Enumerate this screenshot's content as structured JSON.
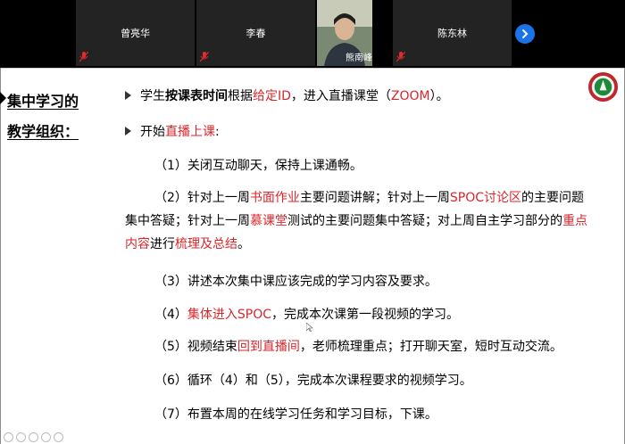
{
  "participants": [
    {
      "name": "曾亮华",
      "muted": true
    },
    {
      "name": "李春",
      "muted": true
    },
    {
      "name": "熊南峰",
      "video": true
    },
    {
      "name": "陈东林",
      "muted": true
    }
  ],
  "nav": {
    "next_icon": "chevron-right-icon",
    "color": "#1a73e8"
  },
  "slide": {
    "side_title_line1": "集中学习的",
    "side_title_line2": "教学组织：",
    "b1": {
      "p1": "学生",
      "p2": "按课表时间",
      "p3": "根据",
      "p4": "给定ID",
      "p5": "，进入直播课堂（",
      "p6": "ZOOM",
      "p7": "）。"
    },
    "b2": {
      "p1": "开始",
      "p2": "直播上课",
      "p3": ":"
    },
    "i1": "（1）关闭互动聊天，保持上课通畅。",
    "i2": {
      "p1": "（2）针对上一周",
      "p2": "书面作业",
      "p3": "主要问题讲解；针对上一周",
      "p4": "SPOC讨论区",
      "p5": "的主要问题集中答疑；针对上一周",
      "p6": "慕课堂",
      "p7": "测试的主要问题集中答疑；对上周自主学习部分的",
      "p8": "重点内容",
      "p9": "进行",
      "p10": "梳理及总结",
      "p11": "。"
    },
    "i3": "（3）讲述本次集中课应该完成的学习内容及要求。",
    "i4": {
      "p1": "（4）",
      "p2": "集体进入SPOC",
      "p3": "，完成本次课第一段视频的学习。"
    },
    "i5": {
      "p1": "（5）视频结束",
      "p2": "回到直播间",
      "p3": "，老师梳理重点；打开聊天室，短时互动交流。"
    },
    "i6": "（6）循环（4）和（5），完成本次课程要求的视频学习。",
    "i7": "（7）布置本周的在线学习任务和学习目标，下课。"
  },
  "colors": {
    "accent_red": "#d9262b"
  }
}
